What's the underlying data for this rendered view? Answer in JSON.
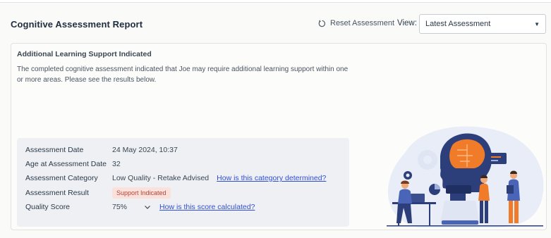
{
  "header": {
    "title": "Cognitive Assessment Report",
    "reset_label": "Reset Assessment",
    "view_label": "View:",
    "view_selected": "Latest Assessment"
  },
  "notice": {
    "heading": "Additional Learning Support Indicated",
    "text": "The completed cognitive assessment indicated that Joe may require additional learning support within one or more areas. Please see the results below."
  },
  "details": {
    "assessment_date": {
      "label": "Assessment Date",
      "value": "24 May 2024, 10:37"
    },
    "age": {
      "label": "Age at Assessment Date",
      "value": "32"
    },
    "category": {
      "label": "Assessment Category",
      "value": "Low Quality - Retake Advised",
      "link": "How is this category determined?"
    },
    "result": {
      "label": "Assessment Result",
      "badge": "Support Indicated"
    },
    "quality": {
      "label": "Quality Score",
      "value": "75%",
      "link": "How is this score calculated?"
    }
  },
  "colors": {
    "link": "#2f4fd6",
    "badge_bg": "#fbe1dc",
    "badge_text": "#b04535",
    "illustration_accent": "#f07c2a"
  }
}
